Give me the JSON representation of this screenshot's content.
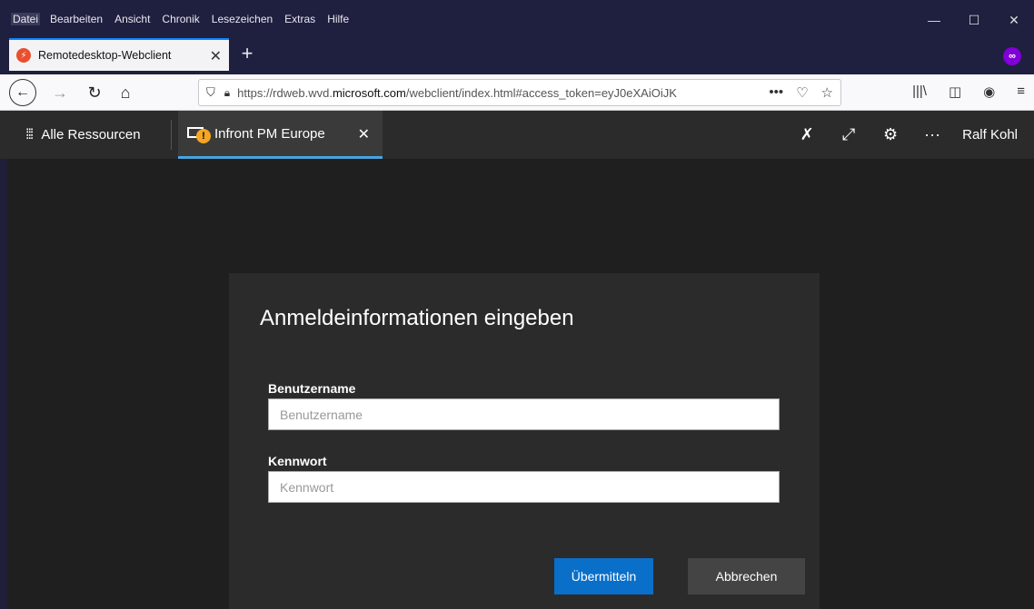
{
  "menu": [
    "Datei",
    "Bearbeiten",
    "Ansicht",
    "Chronik",
    "Lesezeichen",
    "Extras",
    "Hilfe"
  ],
  "window_controls": {
    "minimize": "—",
    "maximize": "☐",
    "close": "✕"
  },
  "browser_tab": {
    "title": "Remotedesktop-Webclient",
    "close": "✕",
    "new_tab": "+"
  },
  "private_mask": "∞",
  "nav": {
    "back": "←",
    "forward": "→",
    "reload": "↻",
    "home": "⌂",
    "url_prefix": "https://rdweb.wvd.",
    "url_domain": "microsoft.com",
    "url_suffix": "/webclient/index.html#access_token=eyJ0eXAiOiJK",
    "url_more": "•••",
    "pocket": "♡",
    "star": "☆",
    "library": "|||\\",
    "sidebar": "◫",
    "account": "◉",
    "menu": "≡"
  },
  "app": {
    "all_resources": "Alle Ressourcen",
    "grid_icon": "⁞⁞⁞",
    "session_name": "Infront PM Europe",
    "session_close": "✕",
    "unpin": "✗",
    "fullscreen": "⤢",
    "settings": "⚙",
    "more": "···",
    "user": "Ralf Kohl"
  },
  "dialog": {
    "title": "Anmeldeinformationen eingeben",
    "username_label": "Benutzername",
    "username_placeholder": "Benutzername",
    "password_label": "Kennwort",
    "password_placeholder": "Kennwort",
    "submit": "Übermitteln",
    "cancel": "Abbrechen"
  }
}
